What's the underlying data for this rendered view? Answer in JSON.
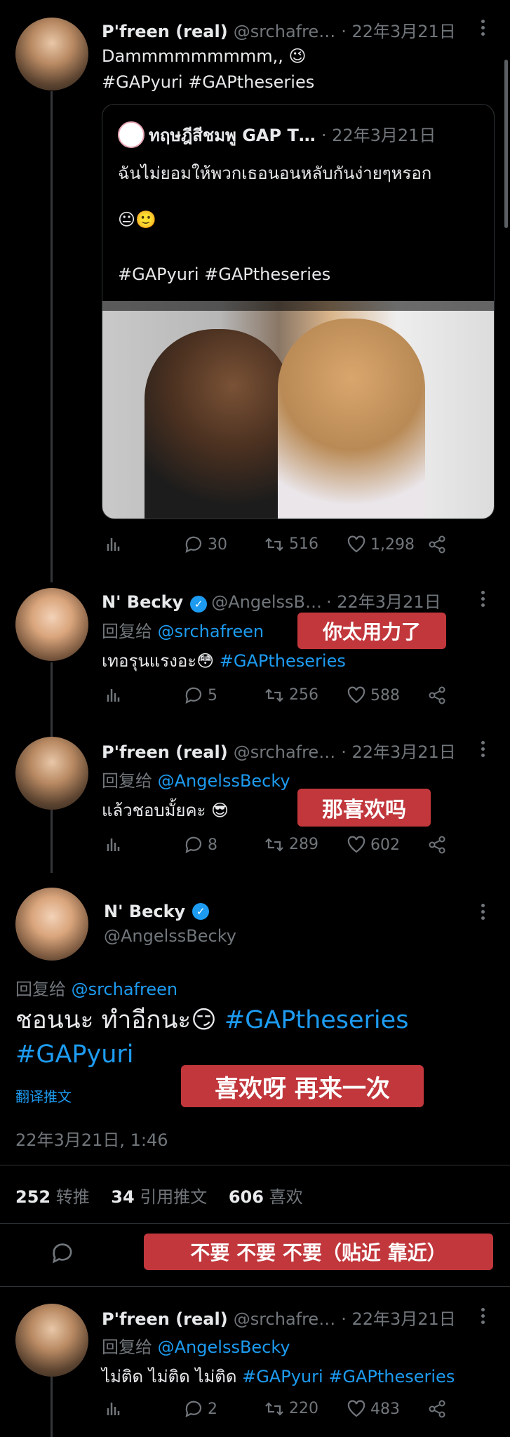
{
  "tweets": [
    {
      "name": "P'freen (real)",
      "handle": "@srchafre…",
      "date": "· 22年3月21日",
      "text": "Dammmmmmmmm,, 😉",
      "hashtags": "#GAPyuri #GAPtheseries",
      "quote": {
        "name": "ทฤษฎีสีชมพู GAP T…",
        "date": "· 22年3月21日",
        "line1": "ฉันไม่ยอมให้พวกเธอนอนหลับกันง่ายๆหรอก",
        "emoji": "😐🙂",
        "hashtags": "#GAPyuri #GAPtheseries"
      },
      "replies": "30",
      "retweets": "516",
      "likes": "1,298"
    },
    {
      "name": "N' Becky",
      "handle": "@AngelssB…",
      "date": "· 22年3月21日",
      "reply_label": "回复给",
      "reply_to": "@srchafreen",
      "text": "เทอรุนแรงอะ😳",
      "hashtag": "#GAPtheseries",
      "overlay": "你太用力了",
      "replies": "5",
      "retweets": "256",
      "likes": "588"
    },
    {
      "name": "P'freen (real)",
      "handle": "@srchafre…",
      "date": "· 22年3月21日",
      "reply_label": "回复给",
      "reply_to": "@AngelssBecky",
      "text": "แล้วชอบมั้ยคะ 😎",
      "overlay": "那喜欢吗",
      "replies": "8",
      "retweets": "289",
      "likes": "602"
    }
  ],
  "focus": {
    "name": "N' Becky",
    "handle": "@AngelssBecky",
    "reply_label": "回复给",
    "reply_to": "@srchafreen",
    "text": "ชอนนะ ทำอีกนะ😏",
    "hashtag1": "#GAPtheseries",
    "hashtag2": "#GAPyuri",
    "translate": "翻译推文",
    "overlay": "喜欢呀 再来一次",
    "timestamp": "22年3月21日, 1:46",
    "stats": {
      "retweets_num": "252",
      "retweets_label": "转推",
      "quotes_num": "34",
      "quotes_label": "引用推文",
      "likes_num": "606",
      "likes_label": "喜欢"
    },
    "overlay2": "不要 不要 不要（贴近 靠近）"
  },
  "last": {
    "name": "P'freen (real)",
    "handle": "@srchafre…",
    "date": "· 22年3月21日",
    "reply_label": "回复给",
    "reply_to": "@AngelssBecky",
    "text": "ไม่ติด ไม่ติด ไม่ติด",
    "hashtags": "#GAPyuri #GAPtheseries",
    "replies": "2",
    "retweets": "220",
    "likes": "483"
  },
  "colors": {
    "link": "#1d9bf0",
    "overlay": "#c1373c",
    "muted": "#71767b"
  }
}
